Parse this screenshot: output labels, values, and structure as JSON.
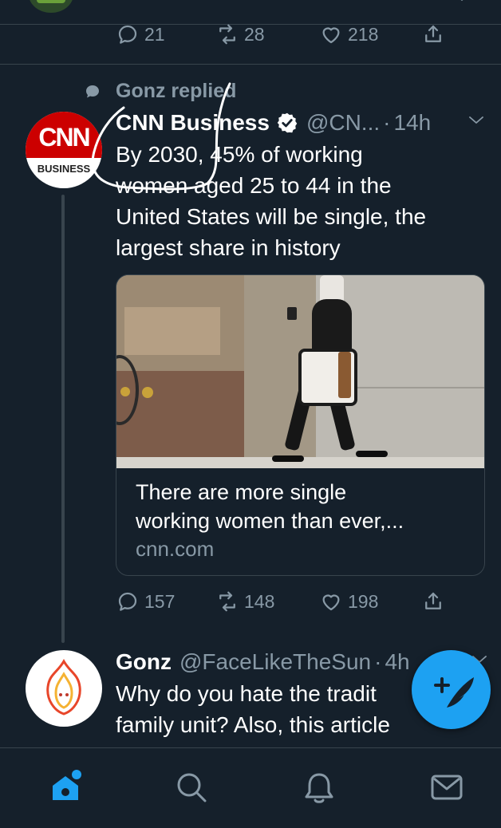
{
  "prev_tweet": {
    "actions": {
      "replies": "21",
      "retweets": "28",
      "likes": "218"
    }
  },
  "context": {
    "label": "Gonz replied"
  },
  "main_tweet": {
    "name": "CNN Business",
    "handle": "@CN...",
    "time": "14h",
    "text_lines": [
      "By 2030, 45% of working",
      "women aged 25 to 44 in the",
      "United States will be single, the",
      "largest share in history"
    ],
    "avatar": {
      "logo_text": "CNN",
      "sub_text": "BUSINESS"
    },
    "card": {
      "title_lines": [
        "There are more single",
        "working women than ever,..."
      ],
      "domain": "cnn.com"
    },
    "actions": {
      "replies": "157",
      "retweets": "148",
      "likes": "198"
    }
  },
  "reply_tweet": {
    "name": "Gonz",
    "handle": "@FaceLikeTheSun",
    "time": "4h",
    "text_lines": [
      "Why do you hate the tradit",
      "family unit? Also, this article"
    ]
  },
  "compose": {
    "icon": "compose-quill-icon"
  },
  "bottom_nav": [
    {
      "icon": "home-icon",
      "active": true
    },
    {
      "icon": "search-icon"
    },
    {
      "icon": "notifications-bell-icon"
    },
    {
      "icon": "messages-envelope-icon"
    }
  ],
  "colors": {
    "background": "#15202b",
    "accent": "#1da1f2",
    "muted": "#8899a6",
    "divider": "#38444d",
    "cnn_red": "#cc0000"
  }
}
